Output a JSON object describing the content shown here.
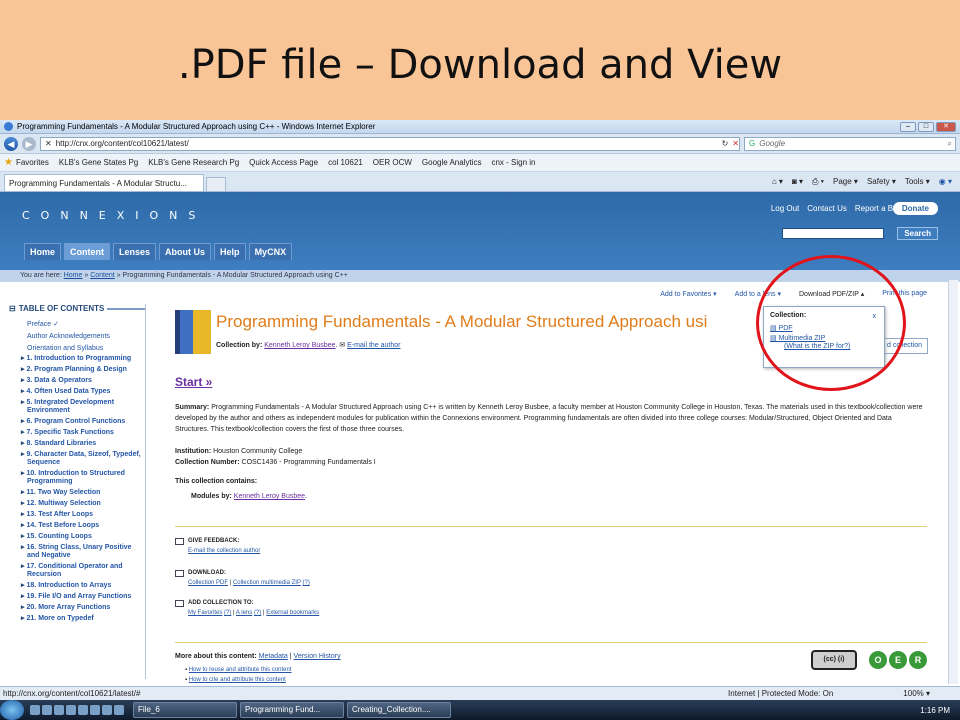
{
  "slide": {
    "title": ".PDF file – Download and View"
  },
  "window": {
    "title": "Programming Fundamentals - A Modular Structured Approach using C++ - Windows Internet Explorer"
  },
  "address": {
    "url": "http://cnx.org/content/col10621/latest/",
    "search_placeholder": "Google"
  },
  "favorites": {
    "label": "Favorites",
    "items": [
      "KLB's Gene States Pg",
      "KLB's Gene Research Pg",
      "Quick Access Page",
      "col 10621",
      "OER OCW",
      "Google Analytics",
      "cnx - Sign in"
    ]
  },
  "tab": {
    "label": "Programming Fundamentals - A Modular Structu..."
  },
  "ie_tools": [
    "Page ▾",
    "Safety ▾",
    "Tools ▾"
  ],
  "site": {
    "logo": "CONNEXIONS",
    "top_links": [
      "Log Out",
      "Contact Us",
      "Report a Bug"
    ],
    "donate": "Donate",
    "search_button": "Search",
    "nav": [
      "Home",
      "Content",
      "Lenses",
      "About Us",
      "Help",
      "MyCNX"
    ],
    "breadcrumb_prefix": "You are here:",
    "breadcrumb": [
      "Home",
      "Content",
      "Programming Fundamentals - A Modular Structured Approach using C++"
    ]
  },
  "toc": {
    "title": "TABLE OF CONTENTS",
    "plain": [
      "Preface ✓",
      "Author Acknowledgements",
      "Orientation and Syllabus"
    ],
    "chapters": [
      "1. Introduction to Programming",
      "2. Program Planning & Design",
      "3. Data & Operators",
      "4. Often Used Data Types",
      "5. Integrated Development Environment",
      "6. Program Control Functions",
      "7. Specific Task Functions",
      "8. Standard Libraries",
      "9. Character Data, Sizeof, Typedef, Sequence",
      "10. Introduction to Structured Programming",
      "11. Two Way Selection",
      "12. Multiway Selection",
      "13. Test After Loops",
      "14. Test Before Loops",
      "15. Counting Loops",
      "16. String Class, Unary Positive and Negative",
      "17. Conditional Operator and Recursion",
      "18. Introduction to Arrays",
      "19. File I/O and Array Functions",
      "20. More Array Functions",
      "21. More on Typedef"
    ]
  },
  "actions": [
    "Add to Favorites ▾",
    "Add to a lens ▾",
    "Download PDF/ZIP ▴",
    "Print this page"
  ],
  "collection": {
    "title": "Programming Fundamentals - A Modular Structured Approach usi",
    "by_label": "Collection by:",
    "author": "Kenneth Leroy Busbee",
    "email": "E-mail the author",
    "start": "Start »",
    "summary_label": "Summary:",
    "summary": "Programming Fundamentals - A Modular Structured Approach using C++ is written by Kenneth Leroy Busbee, a faculty member at Houston Community College in Houston, Texas. The materials used in this textbook/collection were developed by the author and others as independent modules for publication within the Connexions environment. Programming fundamentals are often divided into three college courses: Modular/Structured, Object Oriented and Data Structures. This textbook/collection covers the first of those three courses.",
    "institution_label": "Institution:",
    "institution": "Houston Community College",
    "number_label": "Collection Number:",
    "number": "COSC1436 - Programming Fundamentals I",
    "contains": "This collection contains:",
    "modules_label": "Modules by:",
    "modules_author": "Kenneth Leroy Busbee"
  },
  "feedback": {
    "title": "GIVE FEEDBACK:",
    "link": "E-mail the collection author"
  },
  "download": {
    "title": "DOWNLOAD:",
    "pdf": "Collection PDF",
    "zip": "Collection multimedia ZIP",
    "q": "(?)"
  },
  "addcoll": {
    "title": "ADD COLLECTION TO:",
    "fav": "My Favorites",
    "lens": "A lens",
    "ext": "External bookmarks",
    "q": "(?)"
  },
  "more": {
    "label": "More about this content:",
    "meta": "Metadata",
    "ver": "Version History",
    "b1": "How to reuse and attribute this content",
    "b2": "How to cite and attribute this content"
  },
  "dropdown": {
    "title": "Collection:",
    "close": "x",
    "pdf": "PDF",
    "zip": "Multimedia ZIP",
    "what": "(What is the ZIP for?)"
  },
  "add_collection_btn": "d collection",
  "status": {
    "url": "http://cnx.org/content/col10621/latest/#",
    "zone": "Internet | Protected Mode: On",
    "zoom": "100% ▾"
  },
  "taskbar": {
    "buttons": [
      "File_6",
      "Programming Fund...",
      "Creating_Collection...."
    ],
    "clock": "1:16 PM"
  },
  "colors": {
    "accent": "#e07d1a",
    "header": "#2f6aa8",
    "slide_bg": "#f9c596",
    "highlight": "#e0141a"
  }
}
